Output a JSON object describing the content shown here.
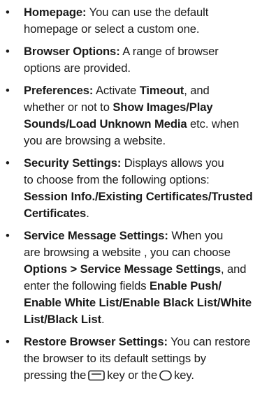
{
  "items": [
    {
      "title": "Homepage:",
      "line1": " You can use the default",
      "line2": "homepage or select a custom one."
    },
    {
      "title": "Browser Options:",
      "line1": " A range of browser",
      "line2": "options are provided."
    },
    {
      "title": "Preferences:",
      "l1a": " Activate ",
      "l1b": "Timeout",
      "l1c": ", and",
      "l2a": "whether or not to ",
      "l2b": "Show Images/Play",
      "l3a": "Sounds/Load Unknown Media",
      "l3b": " etc. when",
      "l4": "you are browsing a website."
    },
    {
      "title": "Security Settings:",
      "line1": " Displays allows you",
      "line2": "to choose from the following options:",
      "line3": "Session Info./Existing Certificates/Trusted",
      "line4": "Certificates",
      "line4b": "."
    },
    {
      "title": "Service Message Settings:",
      "line1": " When you",
      "line2": "are browsing a website , you can choose",
      "l3a": "Options > Service Message Settings",
      "l3b": ", and",
      "l4a": "enter the following fields ",
      "l4b": "Enable Push/",
      "line5": "Enable White List/Enable Black List/White",
      "line6": "List/Black List",
      "line6b": "."
    },
    {
      "title": "Restore Browser Settings:",
      "line1": " You can restore",
      "line2": "the browser to its default settings by",
      "l3a": "pressing the",
      "l3b": "key or the",
      "l3c": "key."
    }
  ],
  "icons": {
    "softkey": "softkey-icon",
    "roundkey": "round-key-icon"
  }
}
